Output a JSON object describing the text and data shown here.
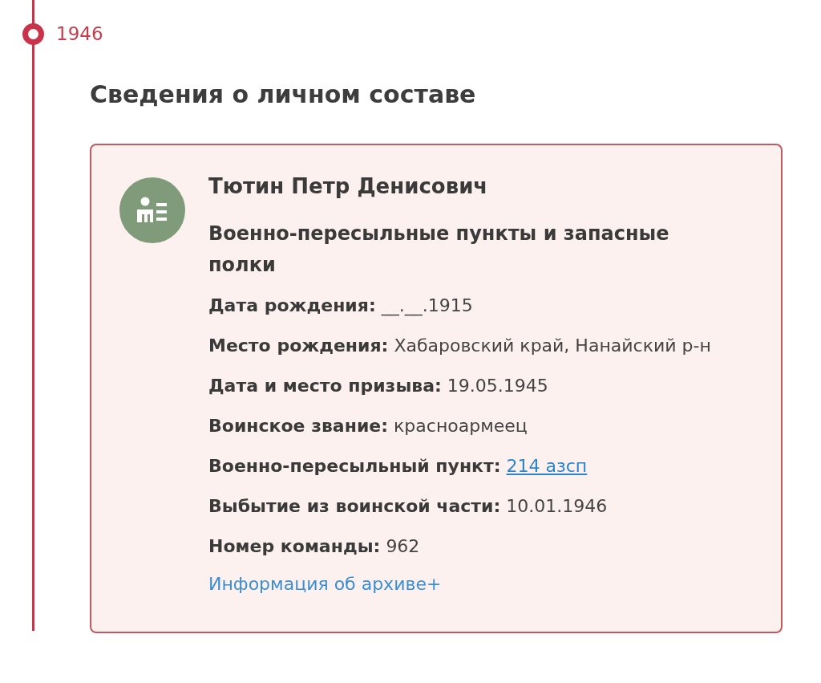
{
  "timeline": {
    "year": "1946"
  },
  "section": {
    "title": "Сведения о личном составе"
  },
  "record": {
    "name": "Тютин Петр Денисович",
    "category": "Военно-пересыльные пункты и запасные полки",
    "fields": [
      {
        "label": "Дата рождения:",
        "value": "__.__.1915",
        "kind": "text"
      },
      {
        "label": "Место рождения:",
        "value": "Хабаровский край, Нанайский р-н",
        "kind": "text"
      },
      {
        "label": "Дата и место призыва:",
        "value": "19.05.1945",
        "kind": "text"
      },
      {
        "label": "Воинское звание:",
        "value": "красноармеец",
        "kind": "text"
      },
      {
        "label": "Военно-пересыльный пункт:",
        "value": "214 азсп",
        "kind": "link"
      },
      {
        "label": "Выбытие из воинской части:",
        "value": "10.01.1946",
        "kind": "text"
      },
      {
        "label": "Номер команды:",
        "value": "962",
        "kind": "text"
      }
    ],
    "archive_link": "Информация об архиве+"
  }
}
